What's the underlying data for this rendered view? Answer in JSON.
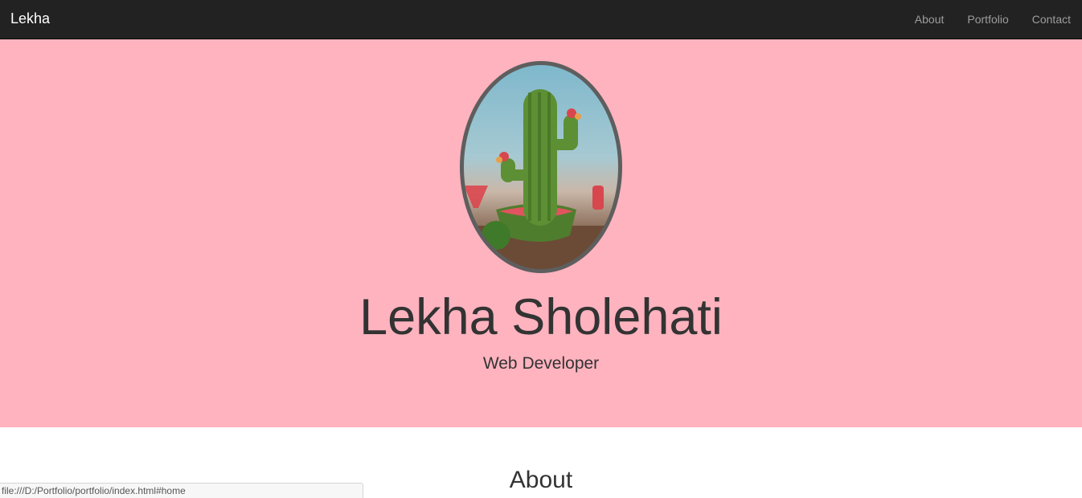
{
  "navbar": {
    "brand": "Lekha",
    "links": [
      {
        "label": "About"
      },
      {
        "label": "Portfolio"
      },
      {
        "label": "Contact"
      }
    ]
  },
  "hero": {
    "name": "Lekha Sholehati",
    "role": "Web Developer",
    "avatar_icon": "watermelon-cactus-photo"
  },
  "about": {
    "title": "About"
  },
  "status_bar": {
    "url": "file:///D:/Portfolio/portfolio/index.html#home"
  },
  "colors": {
    "navbar_bg": "#222222",
    "hero_bg": "#ffb3bf",
    "text": "#333333",
    "nav_link": "#9d9d9d",
    "avatar_border": "#5e5e5e"
  }
}
